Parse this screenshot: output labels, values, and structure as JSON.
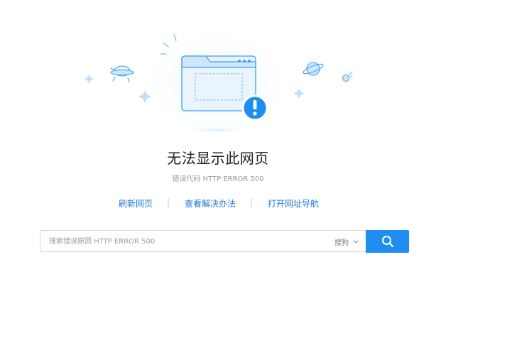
{
  "error": {
    "title": "无法显示此网页",
    "subtitle": "错误代码 HTTP ERROR 500"
  },
  "actions": {
    "refresh": "刷新网页",
    "view_solution": "查看解决办法",
    "open_nav": "打开网址导航",
    "separator": "|"
  },
  "search": {
    "placeholder": "搜索错误原因 HTTP ERROR 500",
    "engine": "搜狗",
    "button_icon": "search-icon"
  },
  "colors": {
    "accent": "#1e8ef0",
    "link": "#1f7ad8",
    "illustration_blue": "#3ea0ef"
  }
}
